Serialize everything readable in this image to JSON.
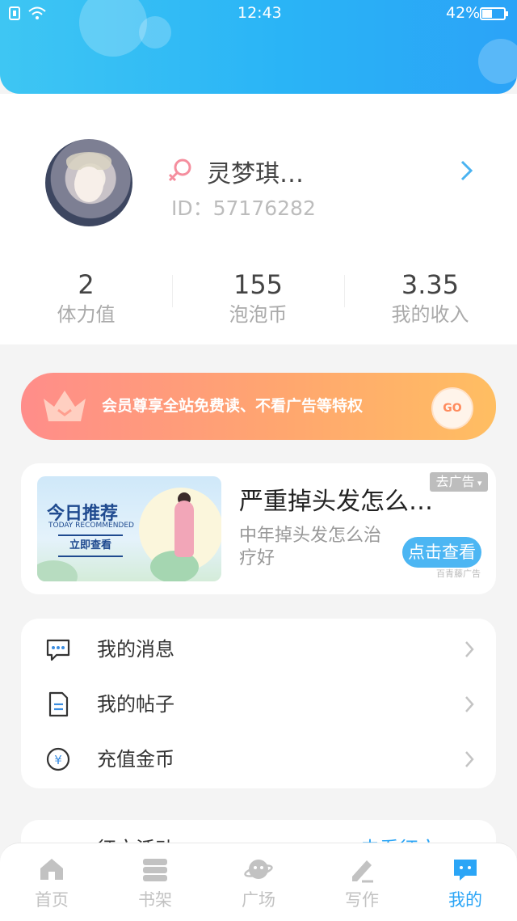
{
  "status_bar": {
    "time": "12:43",
    "battery": "42%"
  },
  "profile": {
    "name": "灵梦琪…",
    "id_text": "ID：57176282",
    "stats": [
      {
        "value": "2",
        "label": "体力值"
      },
      {
        "value": "155",
        "label": "泡泡币"
      },
      {
        "value": "3.35",
        "label": "我的收入"
      }
    ]
  },
  "vip_banner": {
    "text": "会员尊享全站免费读、不看广告等特权",
    "go_label": "GO"
  },
  "ad": {
    "image_title": "今日推荐",
    "image_subtitle": "TODAY RECOMMENDED",
    "image_button": "立即查看",
    "title": "严重掉头发怎么…",
    "description": "中年掉头发怎么治疗好",
    "close_label": "去广告",
    "button_label": "点击查看",
    "source": "百青藤广告"
  },
  "menu": [
    {
      "label": "我的消息",
      "icon": "message-icon"
    },
    {
      "label": "我的帖子",
      "icon": "document-icon"
    },
    {
      "label": "充值金币",
      "icon": "coin-icon"
    }
  ],
  "partial_card": {
    "left_text": "征文活动",
    "right_text": "去看征文"
  },
  "tabs": [
    {
      "label": "首页",
      "icon": "home-icon",
      "active": false
    },
    {
      "label": "书架",
      "icon": "bookshelf-icon",
      "active": false
    },
    {
      "label": "广场",
      "icon": "planet-icon",
      "active": false
    },
    {
      "label": "写作",
      "icon": "pen-icon",
      "active": false
    },
    {
      "label": "我的",
      "icon": "chat-bubble-icon",
      "active": true
    }
  ],
  "colors": {
    "accent": "#2ba5f6",
    "vip_start": "#ff8d8a",
    "vip_end": "#ffbe62"
  }
}
